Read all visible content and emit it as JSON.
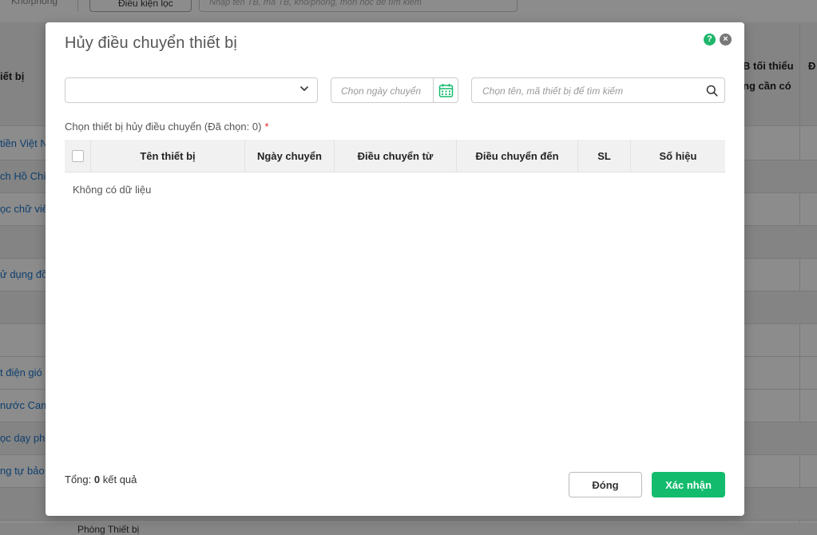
{
  "background": {
    "top": {
      "location_chip": "Kho/phòng",
      "filter_button": "Điều kiện lọc",
      "search_placeholder": "Nhập tên TB, mã TB, kho/phòng, môn học để tìm kiếm"
    },
    "header": {
      "col_equipment": "iết bị",
      "col_min_qty_1": "B tối thiểu",
      "col_min_qty_2": "ng cần có",
      "col_last": "Đ"
    },
    "rows": [
      "tiền Việt N",
      "ch Hồ Chí",
      "ọc chữ viết",
      "",
      "ử dụng đồ",
      "",
      "",
      "t điện gió",
      "nước Cam",
      "ọc dạy ph",
      "ng tự bảo",
      ""
    ],
    "bottom_row": "Phòng Thiết bị"
  },
  "modal": {
    "title": "Hủy điều chuyển thiết bị",
    "help_icon": "question-circle-icon",
    "close_icon": "close-circle-icon",
    "select_value": "",
    "date_placeholder": "Chọn ngày chuyển",
    "search_placeholder": "Chọn tên, mã thiết bị để tìm kiếm",
    "section_label": "Chọn thiết bị hủy điều chuyển (Đã chọn: 0)",
    "required_mark": "*",
    "table": {
      "columns": [
        "Tên thiết bị",
        "Ngày chuyển",
        "Điều chuyển từ",
        "Điều chuyển đến",
        "SL",
        "Số hiệu"
      ],
      "rows": [],
      "empty_text": "Không có dữ liệu"
    },
    "total_prefix": "Tổng:",
    "total_count": "0",
    "total_suffix": "kết quả",
    "close_button": "Đóng",
    "confirm_button": "Xác nhận",
    "colors": {
      "primary": "#13bb6d",
      "help": "#1fb66b",
      "required": "#e02424"
    }
  }
}
